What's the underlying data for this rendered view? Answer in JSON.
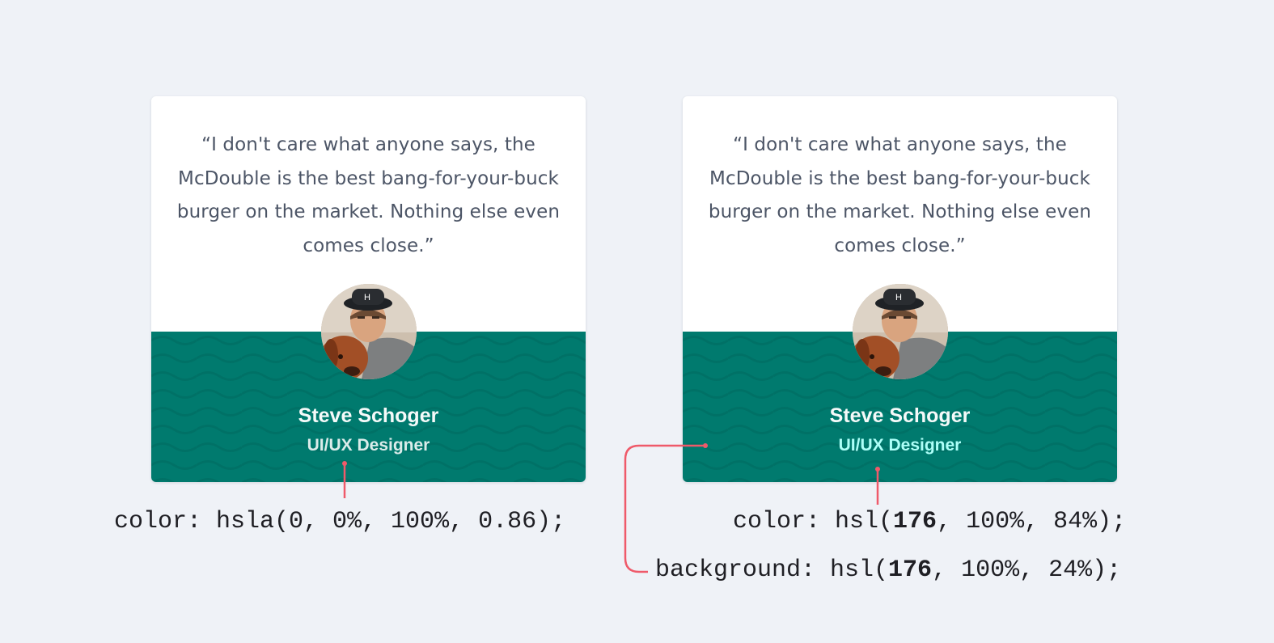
{
  "cards": [
    {
      "quote": "“I don't care what anyone says, the McDouble is the best bang-for-your-buck burger on the market. Nothing else even comes close.”",
      "name": "Steve Schoger",
      "role": "UI/UX Designer"
    },
    {
      "quote": "“I don't care what anyone says, the McDouble is the best bang-for-your-buck burger on the market. Nothing else even comes close.”",
      "name": "Steve Schoger",
      "role": "UI/UX Designer"
    }
  ],
  "annotations": {
    "left_color": "color: hsla(0, 0%, 100%, 0.86);",
    "right_color": {
      "prefix": "color: hsl(",
      "hue": "176",
      "suffix": ", 100%, 84%);"
    },
    "right_background": {
      "prefix": "background: hsl(",
      "hue": "176",
      "suffix": ", 100%, 24%);"
    }
  },
  "colors": {
    "page_background": "#eff2f7",
    "card_background": "#ffffff",
    "footer_teal": "#007a6e",
    "quote_text": "#4c5566",
    "role_left": "hsla(0, 0%, 100%, 0.86)",
    "role_right": "hsl(176, 100%, 84%)",
    "annotation_line": "#ef5a6a"
  }
}
